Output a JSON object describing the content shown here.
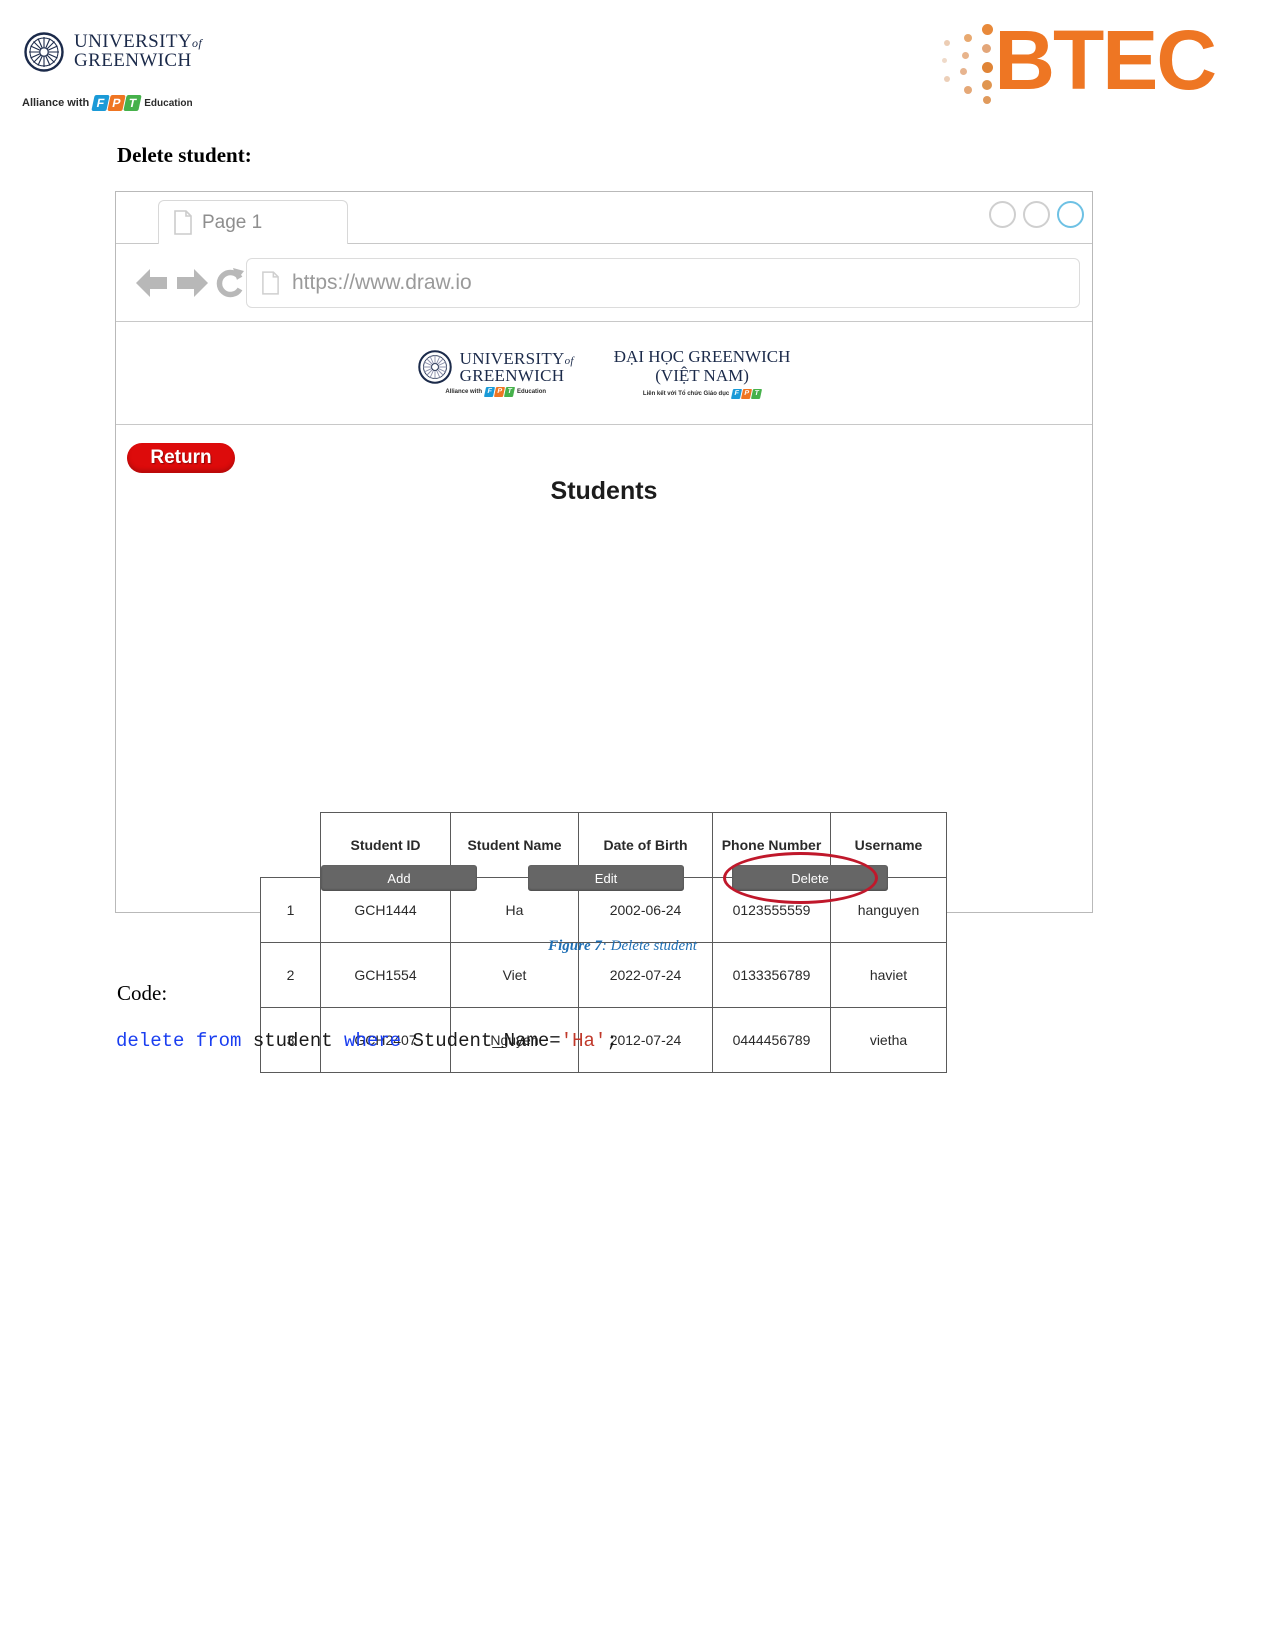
{
  "document": {
    "brand_left": {
      "line1": "UNIVERSITY",
      "of": "of",
      "line2": "GREENWICH",
      "alliance_prefix": "Alliance with",
      "fpt": [
        "F",
        "P",
        "T"
      ],
      "alliance_suffix": "Education",
      "icon": "compass-rose-icon"
    },
    "brand_right": {
      "word": "BTEC",
      "color": "#ee7623",
      "icon": "btec-dot-matrix-icon"
    },
    "heading": "Delete student:",
    "caption_prefix": "Figure 7",
    "caption_suffix": ": Delete student",
    "caption_color": "#1f6fb4",
    "code_label": "Code:",
    "code": {
      "kw_delete": "delete from",
      "table": " student ",
      "kw_where": "where",
      "column": " Student_Name=",
      "value": "'Ha'",
      "terminator": ";"
    }
  },
  "mockup": {
    "tab": {
      "label": "Page 1",
      "icon": "page-document-icon"
    },
    "window_controls": [
      {
        "name": "minimize-circle",
        "color": "#cfcfcf"
      },
      {
        "name": "maximize-circle",
        "color": "#cfcfcf"
      },
      {
        "name": "close-circle",
        "color": "#6ec1e4"
      }
    ],
    "toolbar": {
      "back_icon": "arrow-left-icon",
      "forward_icon": "arrow-right-icon",
      "reload_icon": "reload-icon",
      "url_icon": "page-document-icon",
      "url_value": "https://www.draw.io",
      "url_placeholder": "https://"
    },
    "site_header": {
      "left": {
        "line1": "UNIVERSITY",
        "of": "of",
        "line2": "GREENWICH",
        "alliance_prefix": "Alliance with",
        "fpt": [
          "F",
          "P",
          "T"
        ],
        "alliance_suffix": "Education"
      },
      "right": {
        "line1": "ĐẠI HỌC GREENWICH",
        "line2": "(VIỆT NAM)",
        "alliance_prefix": "Liên kết với Tổ chức Giáo dục",
        "fpt": [
          "F",
          "P",
          "T"
        ]
      }
    },
    "page": {
      "return_label": "Return",
      "return_color": "#dd0b0b",
      "title": "Students",
      "table": {
        "headers": [
          "Student ID",
          "Student Name",
          "Date of Birth",
          "Phone Number",
          "Username"
        ],
        "rows": [
          {
            "index": "1",
            "student_id": "GCH1444",
            "student_name": "Ha",
            "dob": "2002-06-24",
            "phone": "0123555559",
            "username": "hanguyen"
          },
          {
            "index": "2",
            "student_id": "GCH1554",
            "student_name": "Viet",
            "dob": "2022-07-24",
            "phone": "0133356789",
            "username": "haviet"
          },
          {
            "index": "3",
            "student_id": "GCH2407",
            "student_name": "Nguyen",
            "dob": "2012-07-24",
            "phone": "0444456789",
            "username": "vietha"
          }
        ]
      },
      "buttons": [
        {
          "label": "Add",
          "name": "add-button"
        },
        {
          "label": "Edit",
          "name": "edit-button"
        },
        {
          "label": "Delete",
          "name": "delete-button"
        }
      ],
      "highlight": {
        "target": "delete-button",
        "shape": "ellipse",
        "color": "#c0182b"
      }
    }
  }
}
